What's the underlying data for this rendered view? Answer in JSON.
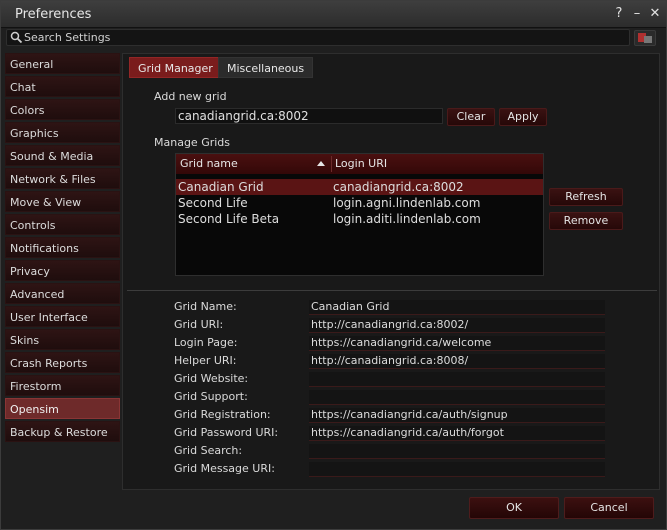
{
  "window": {
    "title": "Preferences",
    "help": "?",
    "minimize": "–",
    "close": "✕"
  },
  "search": {
    "placeholder": "Search Settings"
  },
  "sidebar": {
    "items": [
      {
        "label": "General"
      },
      {
        "label": "Chat"
      },
      {
        "label": "Colors"
      },
      {
        "label": "Graphics"
      },
      {
        "label": "Sound & Media"
      },
      {
        "label": "Network & Files"
      },
      {
        "label": "Move & View"
      },
      {
        "label": "Controls"
      },
      {
        "label": "Notifications"
      },
      {
        "label": "Privacy"
      },
      {
        "label": "Advanced"
      },
      {
        "label": "User Interface"
      },
      {
        "label": "Skins"
      },
      {
        "label": "Crash Reports"
      },
      {
        "label": "Firestorm"
      },
      {
        "label": "Opensim",
        "active": true
      },
      {
        "label": "Backup & Restore"
      }
    ]
  },
  "tabs": {
    "grid_manager": "Grid Manager",
    "misc": "Miscellaneous"
  },
  "add_grid": {
    "label": "Add new grid",
    "value": "canadiangrid.ca:8002",
    "clear": "Clear",
    "apply": "Apply"
  },
  "manage": {
    "label": "Manage Grids",
    "col_name": "Grid name",
    "col_uri": "Login URI",
    "rows": [
      {
        "name": "Canadian Grid",
        "uri": "canadiangrid.ca:8002"
      },
      {
        "name": "Second Life",
        "uri": "login.agni.lindenlab.com"
      },
      {
        "name": "Second Life Beta",
        "uri": "login.aditi.lindenlab.com"
      }
    ],
    "refresh": "Refresh",
    "remove": "Remove"
  },
  "details": [
    {
      "label": "Grid Name:",
      "value": "Canadian Grid"
    },
    {
      "label": "Grid URI:",
      "value": "http://canadiangrid.ca:8002/"
    },
    {
      "label": "Login Page:",
      "value": "https://canadiangrid.ca/welcome"
    },
    {
      "label": "Helper URI:",
      "value": "http://canadiangrid.ca:8008/"
    },
    {
      "label": "Grid Website:",
      "value": ""
    },
    {
      "label": "Grid Support:",
      "value": ""
    },
    {
      "label": "Grid Registration:",
      "value": "https://canadiangrid.ca/auth/signup"
    },
    {
      "label": "Grid Password URI:",
      "value": "https://canadiangrid.ca/auth/forgot"
    },
    {
      "label": "Grid Search:",
      "value": ""
    },
    {
      "label": "Grid Message URI:",
      "value": ""
    }
  ],
  "footer": {
    "ok": "OK",
    "cancel": "Cancel"
  },
  "colors": {
    "accent": "#7a1c1c",
    "selected_row": "#5a1414",
    "active_side": "#6e2a2a"
  }
}
